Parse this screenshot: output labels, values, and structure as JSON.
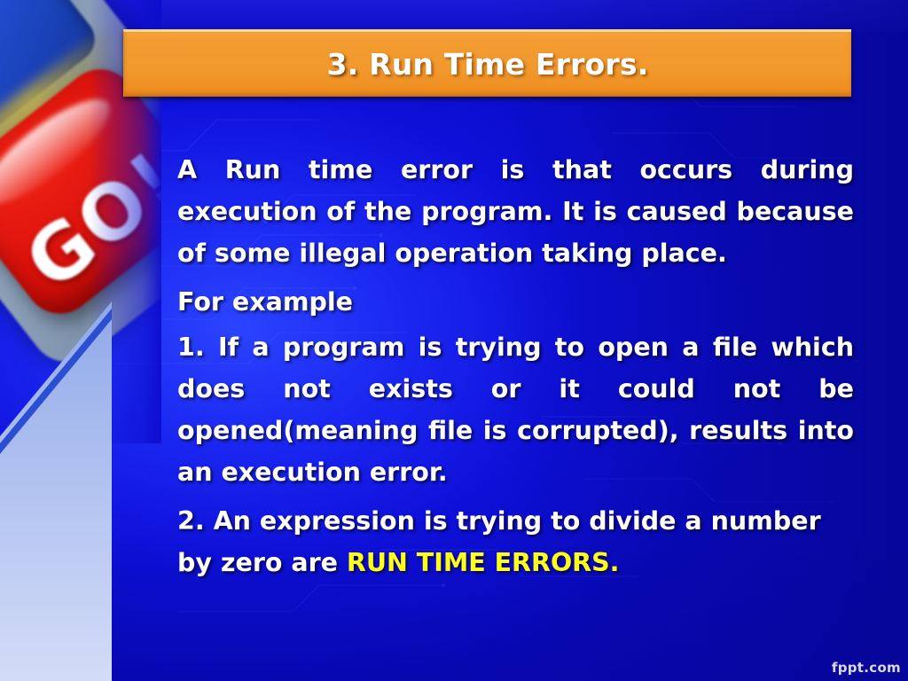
{
  "slide": {
    "title_number": "3.",
    "title_rest": " Run Time Errors.",
    "watermark": "fppt.com"
  },
  "body": {
    "paragraph_1": "A Run time error is that occurs during execution of the program. It is caused because of some illegal operation taking place.",
    "paragraph_2": "For example",
    "paragraph_3": "1. If a program is trying to open a file which does not exists or it could not be opened(meaning file is corrupted), results into an execution error.",
    "paragraph_4_lead": "2. An expression is trying to divide a number by zero are ",
    "paragraph_4_highlight": "RUN TIME ERRORS."
  },
  "decoration": {
    "go_button_label": "GO!"
  },
  "colors": {
    "background_blue": "#0c0cc8",
    "background_glow": "#2b44ff",
    "title_bar_orange": "#f2992e",
    "title_bar_highlight": "#fbd887",
    "text_white": "#ffffff",
    "highlight_yellow": "#ffff1a",
    "go_button_red": "#d8100a",
    "wedge_lavender": "#b8c8f0",
    "watermark_grey": "#e9e9ef"
  }
}
